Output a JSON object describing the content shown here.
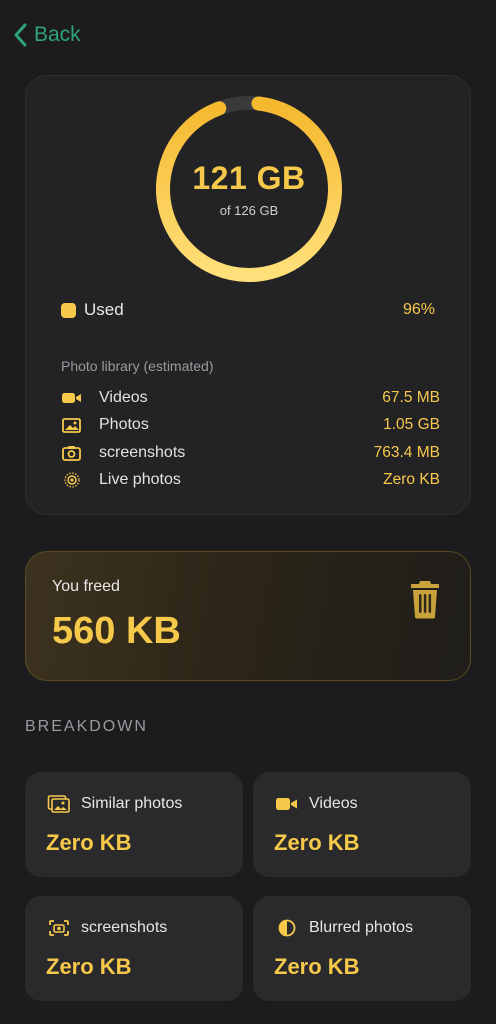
{
  "nav": {
    "back_label": "Back"
  },
  "storage": {
    "used_value": "121 GB",
    "total_text": "of 126 GB",
    "used_fraction": 0.96,
    "used_label": "Used",
    "used_percent": "96%"
  },
  "library": {
    "title": "Photo library (estimated)",
    "items": [
      {
        "icon": "video-icon",
        "label": "Videos",
        "value": "67.5 MB"
      },
      {
        "icon": "photo-icon",
        "label": "Photos",
        "value": "1.05 GB"
      },
      {
        "icon": "screenshot-icon",
        "label": "screenshots",
        "value": "763.4 MB"
      },
      {
        "icon": "live-photo-icon",
        "label": "Live photos",
        "value": "Zero KB"
      }
    ]
  },
  "freed": {
    "label": "You freed",
    "value": "560 KB",
    "icon": "trash-icon"
  },
  "breakdown": {
    "title": "BREAKDOWN",
    "tiles": [
      {
        "icon": "similar-photos-icon",
        "label": "Similar photos",
        "value": "Zero KB"
      },
      {
        "icon": "video-icon",
        "label": "Videos",
        "value": "Zero KB"
      },
      {
        "icon": "screenshot-icon",
        "label": "screenshots",
        "value": "Zero KB"
      },
      {
        "icon": "blurred-photos-icon",
        "label": "Blurred photos",
        "value": "Zero KB"
      }
    ]
  },
  "colors": {
    "accent": "#f7c94b",
    "back": "#2fa37a",
    "background": "#1c1c1e"
  }
}
